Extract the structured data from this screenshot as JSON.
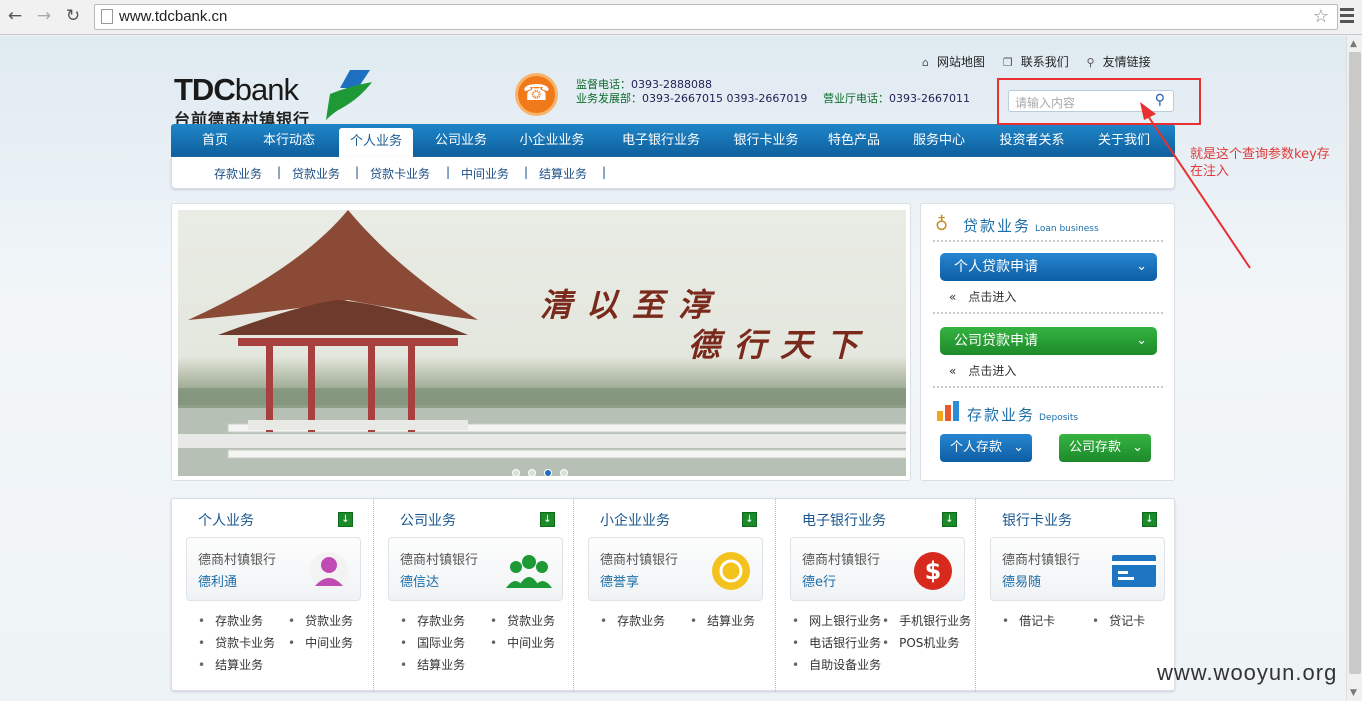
{
  "browser": {
    "url": "www.tdcbank.cn"
  },
  "top_links": [
    "网站地图",
    "联系我们",
    "友情链接"
  ],
  "logo": {
    "en_bold": "TDC",
    "en_light": "bank",
    "cn": "台前德商村镇银行"
  },
  "phones": {
    "supervise_label": "监督电话：",
    "supervise_num": "0393-2888088",
    "business_label": "业务发展部：",
    "business_num": "0393-2667015 0393-2667019",
    "hall_label": "营业厅电话：",
    "hall_num": "0393-2667011"
  },
  "search": {
    "placeholder": "请输入内容"
  },
  "annotation": "就是这个查询参数key存在注入",
  "nav": [
    "首页",
    "本行动态",
    "个人业务",
    "公司业务",
    "小企业业务",
    "电子银行业务",
    "银行卡业务",
    "特色产品",
    "服务中心",
    "投资者关系",
    "关于我们"
  ],
  "nav_active": "个人业务",
  "subnav": [
    "存款业务",
    "贷款业务",
    "贷款卡业务",
    "中间业务",
    "结算业务"
  ],
  "banner": {
    "line1": "清以至淳",
    "line2": "德行天下",
    "slide_count": 4,
    "active_slide": 3
  },
  "side": {
    "loan_title": "贷款业务",
    "loan_en": "Loan business",
    "personal_loan": "个人贷款申请",
    "company_loan": "公司贷款申请",
    "enter": "点击进入",
    "enter_icon": "«",
    "deposit_title": "存款业务",
    "deposit_en": "Deposits",
    "personal_deposit": "个人存款",
    "company_deposit": "公司存款"
  },
  "columns": [
    {
      "title": "个人业务",
      "card1": "德商村镇银行",
      "card2": "德利通",
      "items": [
        "存款业务",
        "贷款业务",
        "贷款卡业务",
        "中间业务",
        "结算业务"
      ]
    },
    {
      "title": "公司业务",
      "card1": "德商村镇银行",
      "card2": "德信达",
      "items": [
        "存款业务",
        "贷款业务",
        "国际业务",
        "中间业务",
        "结算业务"
      ]
    },
    {
      "title": "小企业业务",
      "card1": "德商村镇银行",
      "card2": "德誉享",
      "items": [
        "存款业务",
        "结算业务"
      ]
    },
    {
      "title": "电子银行业务",
      "card1": "德商村镇银行",
      "card2": "德e行",
      "items": [
        "网上银行业务",
        "手机银行业务",
        "电话银行业务",
        "POS机业务",
        "自助设备业务"
      ]
    },
    {
      "title": "银行卡业务",
      "card1": "德商村镇银行",
      "card2": "德易随",
      "items": [
        "借记卡",
        "贷记卡"
      ]
    }
  ],
  "watermark": "www.wooyun.org",
  "colors": {
    "nav_blue": "#0e5e9c",
    "green": "#1d8a2a",
    "annotation_red": "#e83030",
    "phone_orange": "#f07a1a"
  }
}
